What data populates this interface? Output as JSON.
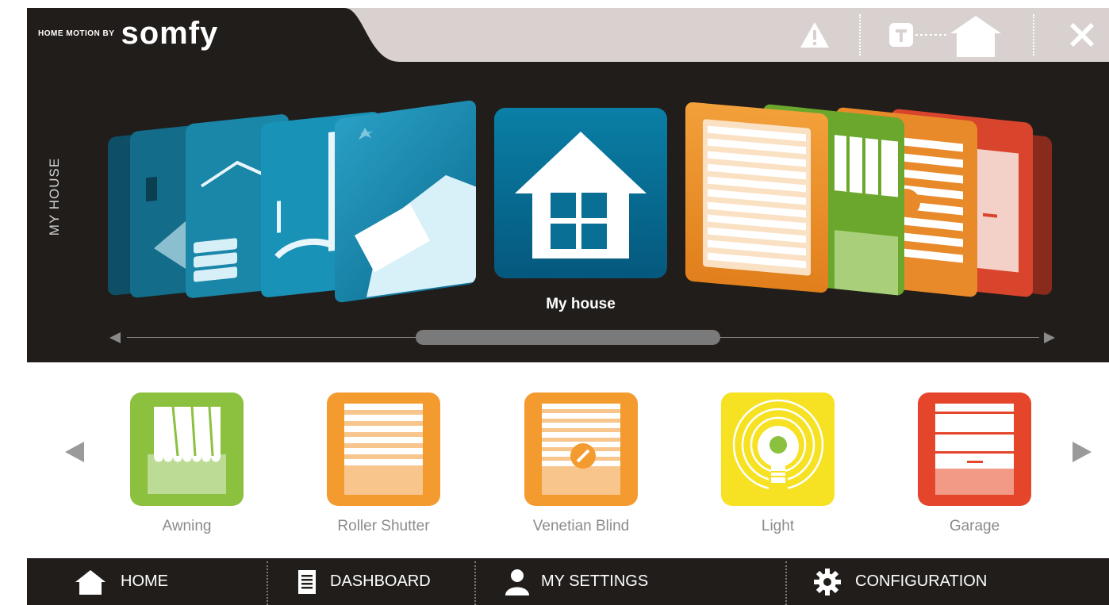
{
  "header": {
    "brand_small": "HOME MOTION BY",
    "brand_name": "somfy",
    "icons": [
      "warning-icon",
      "timer-icon",
      "house-icon",
      "close-icon"
    ]
  },
  "carousel": {
    "side_label": "MY HOUSE",
    "selected_label": "My house",
    "selected_icon": "house-icon"
  },
  "devices": [
    {
      "label": "Awning",
      "color": "#8cc03f"
    },
    {
      "label": "Roller Shutter",
      "color": "#f39b2f"
    },
    {
      "label": "Venetian Blind",
      "color": "#f39b2f"
    },
    {
      "label": "Light",
      "color": "#f6e122"
    },
    {
      "label": "Garage",
      "color": "#e5452a"
    }
  ],
  "nav": {
    "home": "HOME",
    "dashboard": "DASHBOARD",
    "settings": "MY SETTINGS",
    "configuration": "CONFIGURATION"
  }
}
